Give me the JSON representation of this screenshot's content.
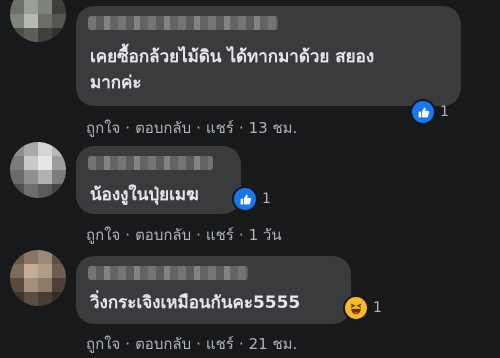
{
  "comments": [
    {
      "text_lines": [
        "เคยซื้อกล้วยไม้ดิน ได้ทากมาด้วย สยอง",
        "มากค่ะ"
      ],
      "reaction": {
        "type": "like",
        "count": "1"
      },
      "actions": {
        "like": "ถูกใจ",
        "reply": "ตอบกลับ",
        "share": "แชร์",
        "time": "13 ชม."
      },
      "avatar_colors": [
        "#5a5e58",
        "#6e7369",
        "#8c8f84",
        "#4b4f47",
        "#6c7065",
        "#9aa092",
        "#7f8378",
        "#3d403a",
        "#80857a",
        "#b6b9ae",
        "#6b6f66",
        "#53574f",
        "#4a4d46",
        "#5c6058",
        "#3f423c",
        "#2f312d"
      ]
    },
    {
      "text_lines": [
        "น้องงูในปุ่ยเมฆ"
      ],
      "reaction": {
        "type": "like",
        "count": "1"
      },
      "actions": {
        "like": "ถูกใจ",
        "reply": "ตอบกลับ",
        "share": "แชร์",
        "time": "1 วัน"
      },
      "avatar_colors": [
        "#8e8e8e",
        "#a9a9a9",
        "#d4d4d4",
        "#b8b8b8",
        "#7b7b7b",
        "#c9c9c9",
        "#e6e6e6",
        "#9c9c9c",
        "#6a6a6a",
        "#8f8f8f",
        "#b1b1b1",
        "#7d7d7d",
        "#4f4f4f",
        "#6e6e6e",
        "#5b5b5b",
        "#454545"
      ]
    },
    {
      "text_lines": [
        "วิ่งกระเจิงเหมือนกันคะ5555"
      ],
      "reaction": {
        "type": "haha",
        "count": "1"
      },
      "actions": {
        "like": "ถูกใจ",
        "reply": "ตอบกลับ",
        "share": "แชร์",
        "time": "21 ชม."
      },
      "avatar_colors": [
        "#6b5a4c",
        "#8a7664",
        "#9c8a78",
        "#5d4e42",
        "#7c6a5a",
        "#c3ad95",
        "#b29c86",
        "#6f5e50",
        "#5a4b3f",
        "#a38f7a",
        "#8d7a68",
        "#4d4037",
        "#3f352d",
        "#5b4d41",
        "#4a3e34",
        "#342c25"
      ]
    }
  ]
}
